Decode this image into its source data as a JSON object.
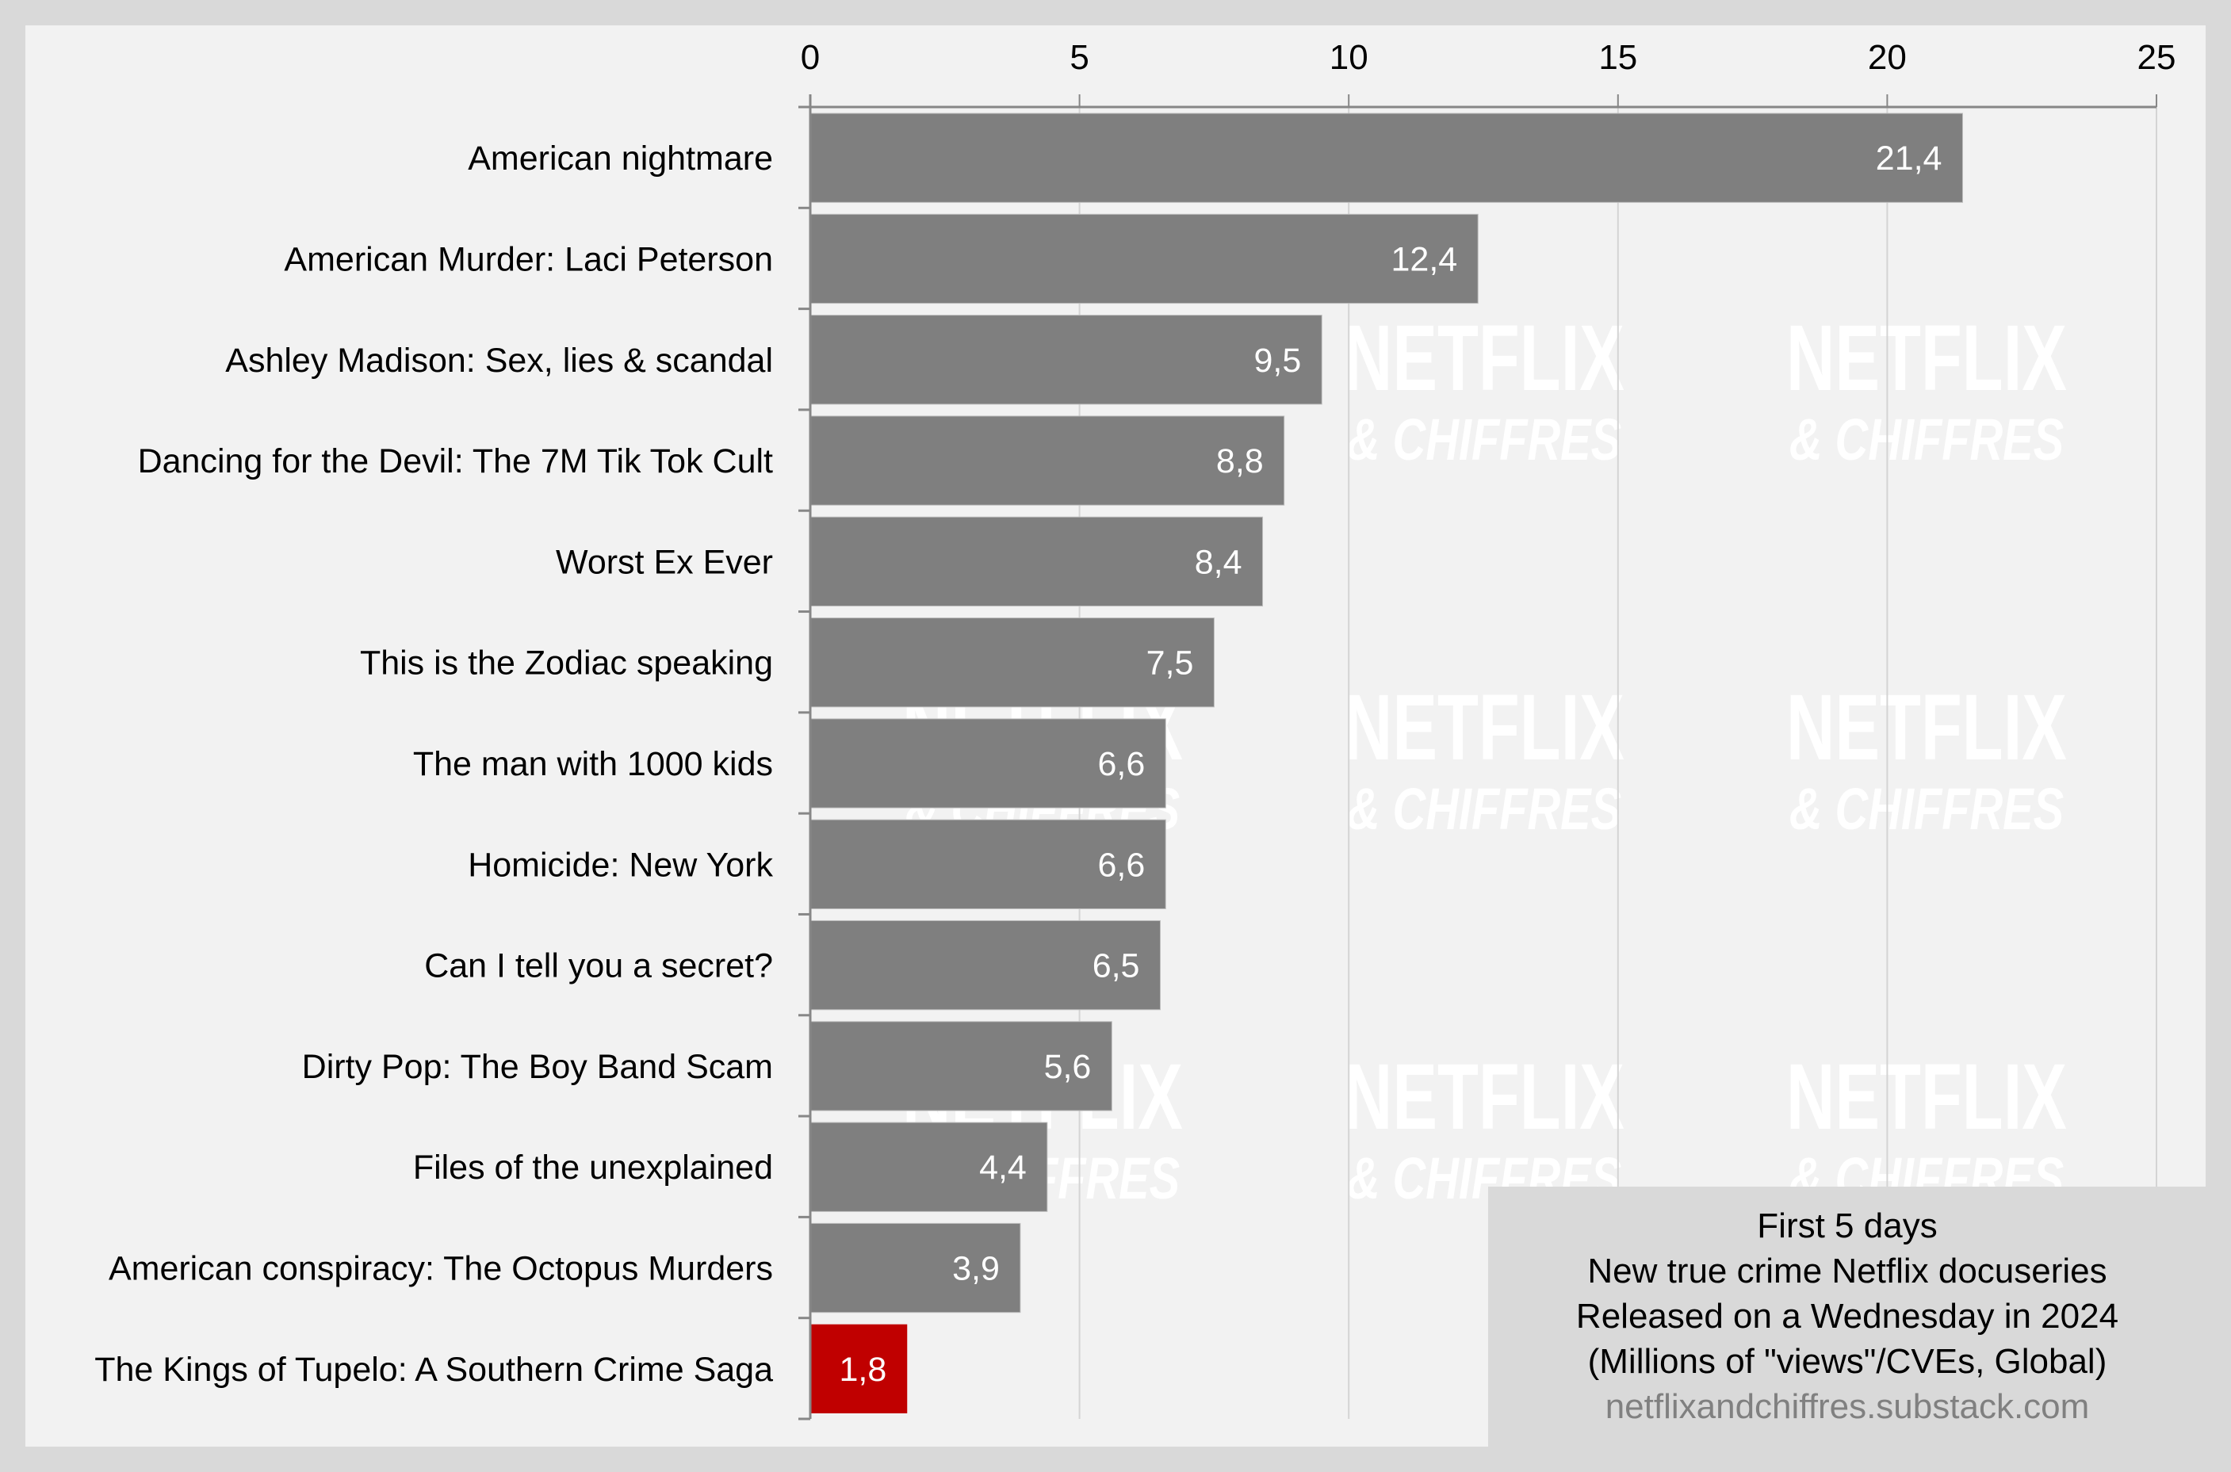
{
  "chart_data": {
    "type": "bar",
    "orientation": "horizontal",
    "categories": [
      "American nightmare",
      "American Murder: Laci Peterson",
      "Ashley Madison: Sex, lies & scandal",
      "Dancing for the Devil: The 7M Tik Tok Cult",
      "Worst Ex Ever",
      "This is the Zodiac speaking",
      "The man with 1000 kids",
      "Homicide: New York",
      "Can I tell you a secret?",
      "Dirty Pop: The Boy Band Scam",
      "Files of the unexplained",
      "American conspiracy: The Octopus Murders",
      "The Kings of Tupelo: A Southern Crime Saga"
    ],
    "values": [
      21.4,
      12.4,
      9.5,
      8.8,
      8.4,
      7.5,
      6.6,
      6.6,
      6.5,
      5.6,
      4.4,
      3.9,
      1.8
    ],
    "value_labels": [
      "21,4",
      "12,4",
      "9,5",
      "8,8",
      "8,4",
      "7,5",
      "6,6",
      "6,6",
      "6,5",
      "5,6",
      "4,4",
      "3,9",
      "1,8"
    ],
    "highlighted_index": 12,
    "colors": {
      "default": "#7f7f7f",
      "highlight": "#c00000",
      "value_label": "#ffffff"
    },
    "x_axis": {
      "position": "top",
      "range": [
        0,
        25
      ],
      "ticks": [
        0,
        5,
        10,
        15,
        20,
        25
      ],
      "tick_labels": [
        "0",
        "5",
        "10",
        "15",
        "20",
        "25"
      ]
    },
    "grid": true,
    "title": "",
    "xlabel": "",
    "ylabel": "",
    "annotation": {
      "lines": [
        "First 5 days",
        "New true crime Netflix docuseries",
        "Released on a Wednesday in 2024",
        "(Millions of \"views\"/CVEs, Global)"
      ],
      "source": "netflixandchiffres.substack.com",
      "placement": "bottom-right"
    },
    "watermark": {
      "line1": "NETFLIX",
      "line2": "& CHIFFRES"
    }
  },
  "colors": {
    "outer_background": "#d9d9d9",
    "panel_background": "#f2f2f2",
    "axis": "#878787",
    "grid": "#d4d4d4",
    "source_text": "#808080"
  }
}
